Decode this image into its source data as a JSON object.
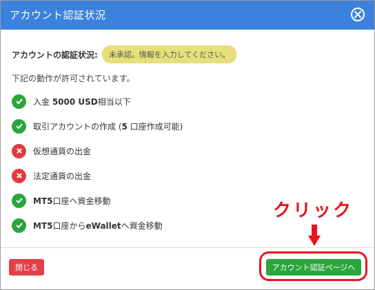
{
  "dialog": {
    "title": "アカウント認証状況",
    "close_icon": "close-circle-icon"
  },
  "status": {
    "label": "アカウントの認証状況:",
    "badge": "未承認。情報を入力してください。",
    "badge_color": "#e6df7a"
  },
  "intro": "下記の動作が許可されています。",
  "permissions": [
    {
      "text_bold": "",
      "text": "入金 ",
      "bold_mid": "5000 USD",
      "text_after": "相当以下",
      "allowed": true
    },
    {
      "text": "取引アカウントの作成 (",
      "bold_mid": "5",
      "text_after": " 口座作成可能)",
      "allowed": true
    },
    {
      "text": "仮想通貨の出金",
      "bold_mid": "",
      "text_after": "",
      "allowed": false
    },
    {
      "text": "法定通貨の出金",
      "bold_mid": "",
      "text_after": "",
      "allowed": false
    },
    {
      "text": "",
      "bold_mid": "MT5",
      "text_after": "口座へ資金移動",
      "allowed": true
    },
    {
      "text": "",
      "bold_mid": "MT5",
      "text_after": "口座から",
      "bold_mid2": "eWallet",
      "text_after2": "へ資金移動",
      "allowed": true
    }
  ],
  "footer": {
    "close_label": "閉じる",
    "verify_label": "アカウント認証ページへ"
  },
  "annotation": {
    "click_text": "クリック",
    "color": "#e8141b"
  },
  "colors": {
    "header": "#3b82de",
    "allowed": "#2aa63c",
    "denied": "#e23b3e",
    "close_button": "#e2414a",
    "verify_button": "#2aa63c"
  }
}
